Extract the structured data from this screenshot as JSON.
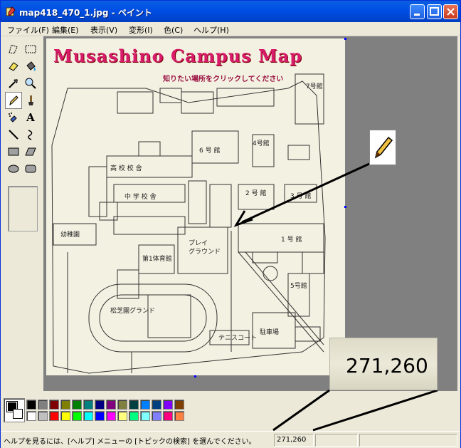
{
  "window": {
    "title": "map418_470_1.jpg - ペイント"
  },
  "menu": {
    "items": [
      {
        "label": "ファイル(F)"
      },
      {
        "label": "編集(E)"
      },
      {
        "label": "表示(V)"
      },
      {
        "label": "変形(I)"
      },
      {
        "label": "色(C)"
      },
      {
        "label": "ヘルプ(H)"
      }
    ]
  },
  "tools": [
    {
      "name": "free-select-icon"
    },
    {
      "name": "rect-select-icon"
    },
    {
      "name": "eraser-icon"
    },
    {
      "name": "fill-icon"
    },
    {
      "name": "eyedropper-icon"
    },
    {
      "name": "magnifier-icon"
    },
    {
      "name": "pencil-icon",
      "selected": true
    },
    {
      "name": "brush-icon"
    },
    {
      "name": "airbrush-icon"
    },
    {
      "name": "text-icon",
      "glyph": "A"
    },
    {
      "name": "line-icon"
    },
    {
      "name": "curve-icon"
    },
    {
      "name": "rectangle-icon"
    },
    {
      "name": "polygon-icon"
    },
    {
      "name": "ellipse-icon"
    },
    {
      "name": "rounded-rect-icon"
    }
  ],
  "canvas": {
    "map_title": "Musashino Campus Map",
    "map_subtitle": "知りたい場所をクリックしてください"
  },
  "palette": {
    "foreground": "#000000",
    "background": "#ffffff",
    "colors": [
      "#000000",
      "#808080",
      "#800000",
      "#808000",
      "#008000",
      "#008080",
      "#000080",
      "#800080",
      "#808040",
      "#004040",
      "#0080ff",
      "#004080",
      "#8000ff",
      "#804000",
      "#ffffff",
      "#c0c0c0",
      "#ff0000",
      "#ffff00",
      "#00ff00",
      "#00ffff",
      "#0000ff",
      "#ff00ff",
      "#ffff80",
      "#00ff80",
      "#80ffff",
      "#8080ff",
      "#ff0080",
      "#ff8040"
    ]
  },
  "status": {
    "help_text": "ヘルプを見るには、[ヘルプ] メニューの [トピックの検索] を選んでください。",
    "coords": "271,260"
  },
  "zoom_callout": {
    "coords": "271,260"
  }
}
